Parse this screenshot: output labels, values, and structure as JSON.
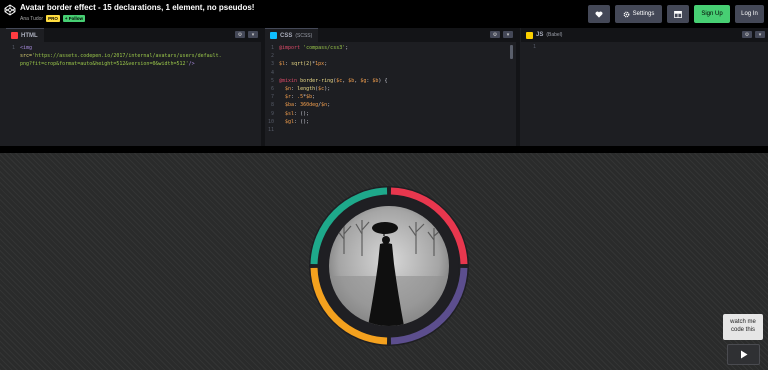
{
  "header": {
    "title": "Avatar border effect - 15 declarations, 1 element, no pseudos!",
    "author": "Ana Tudor",
    "badge_pro": "PRO",
    "badge_follow": "+ Follow",
    "settings_label": "Settings",
    "signup_label": "Sign Up",
    "login_label": "Log In",
    "icons": {
      "logo": "codepen-logo-icon",
      "heart": "heart-icon",
      "settings": "gear-icon",
      "layout": "layout-icon"
    }
  },
  "editors": {
    "html": {
      "label": "HTML",
      "lines": [
        {
          "n": "1",
          "parts": [
            [
              "tag",
              "<img"
            ]
          ]
        },
        {
          "n": "",
          "parts": [
            [
              "attr",
              "src="
            ],
            [
              "str",
              "'https://assets.codepen.io/2017/internal/avatars/users/default."
            ]
          ]
        },
        {
          "n": "",
          "parts": [
            [
              "str",
              "png?fit=crop&format=auto&height=512&version=0&width=512'"
            ],
            [
              "tag",
              "/>"
            ]
          ]
        }
      ]
    },
    "css": {
      "label": "CSS",
      "sublabel": "(SCSS)",
      "lines": [
        {
          "n": "1",
          "parts": [
            [
              "kw",
              "@import"
            ],
            [
              "str",
              " 'compass/css3'"
            ],
            [
              "pl",
              ";"
            ]
          ]
        },
        {
          "n": "2",
          "parts": []
        },
        {
          "n": "3",
          "parts": [
            [
              "var",
              "$l"
            ],
            [
              "pl",
              ": "
            ],
            [
              "fn",
              "sqrt(2)"
            ],
            [
              "pl",
              "*"
            ],
            [
              "var",
              "1px"
            ],
            [
              "pl",
              ";"
            ]
          ]
        },
        {
          "n": "4",
          "parts": []
        },
        {
          "n": "5",
          "parts": [
            [
              "kw",
              "@mixin"
            ],
            [
              "fn",
              " border-ring"
            ],
            [
              "pl",
              "("
            ],
            [
              "var",
              "$c"
            ],
            [
              "pl",
              ", "
            ],
            [
              "var",
              "$b"
            ],
            [
              "pl",
              ", "
            ],
            [
              "var",
              "$g"
            ],
            [
              "pl",
              ": "
            ],
            [
              "var",
              "$b"
            ],
            [
              "pl",
              ") {"
            ]
          ]
        },
        {
          "n": "6",
          "parts": [
            [
              "pl",
              "  "
            ],
            [
              "var",
              "$n"
            ],
            [
              "pl",
              ": "
            ],
            [
              "fn",
              "length"
            ],
            [
              "pl",
              "("
            ],
            [
              "var",
              "$c"
            ],
            [
              "pl",
              ");"
            ]
          ]
        },
        {
          "n": "7",
          "parts": [
            [
              "pl",
              "  "
            ],
            [
              "var",
              "$r"
            ],
            [
              "pl",
              ": "
            ],
            [
              "var",
              ".5"
            ],
            [
              "pl",
              "*"
            ],
            [
              "var",
              "$b"
            ],
            [
              "pl",
              ";"
            ]
          ]
        },
        {
          "n": "8",
          "parts": [
            [
              "pl",
              "  "
            ],
            [
              "var",
              "$ba"
            ],
            [
              "pl",
              ": "
            ],
            [
              "var",
              "360deg"
            ],
            [
              "pl",
              "/"
            ],
            [
              "var",
              "$n"
            ],
            [
              "pl",
              ";"
            ]
          ]
        },
        {
          "n": "9",
          "parts": [
            [
              "pl",
              "  "
            ],
            [
              "var",
              "$sl"
            ],
            [
              "pl",
              ": ();"
            ]
          ]
        },
        {
          "n": "10",
          "parts": [
            [
              "pl",
              "  "
            ],
            [
              "var",
              "$gl"
            ],
            [
              "pl",
              ": ();"
            ]
          ]
        },
        {
          "n": "11",
          "parts": []
        }
      ]
    },
    "js": {
      "label": "JS",
      "sublabel": "(Babel)",
      "first_line": "1"
    },
    "control_icons": {
      "settings": "gear-icon",
      "collapse": "chevron-down-icon"
    }
  },
  "preview": {
    "ring_colors": [
      "#e8374e",
      "#5c4e8e",
      "#f4a11e",
      "#1ea98b"
    ],
    "avatar_desc_icon": "avatar-photo",
    "watch_label_1": "watch me",
    "watch_label_2": "code this",
    "play_icon": "play-icon"
  }
}
